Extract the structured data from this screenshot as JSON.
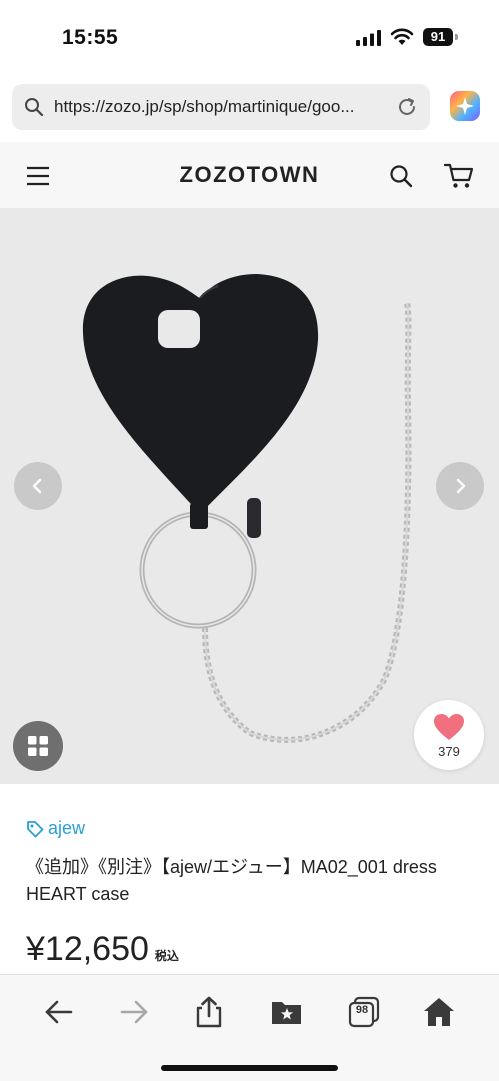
{
  "status_bar": {
    "time": "15:55",
    "battery": "91"
  },
  "browser": {
    "url": "https://zozo.jp/sp/shop/martinique/goo...",
    "icons": [
      "search-icon",
      "reload-icon",
      "ai-assistant-icon"
    ]
  },
  "site_header": {
    "logo": "ZOZOTOWN",
    "icons": [
      "menu-icon",
      "search-icon",
      "cart-icon"
    ]
  },
  "product": {
    "favorite_count": "379",
    "brand": "ajew",
    "title": "《追加》《別注》【ajew/エジュー】MA02_001 dress HEART case",
    "price": "¥12,650",
    "tax_label": "税込",
    "image_nav": [
      "chevron-left-icon",
      "chevron-right-icon"
    ]
  },
  "toolbar": {
    "tabs_count": "98",
    "icons": [
      "back-icon",
      "forward-icon",
      "share-icon",
      "bookmarks-icon",
      "tabs-icon",
      "home-icon"
    ]
  },
  "colors": {
    "brand_link": "#2a9fd6",
    "favorite_heart": "#f0707f",
    "toolbar_icon": "#3a3a3a"
  }
}
